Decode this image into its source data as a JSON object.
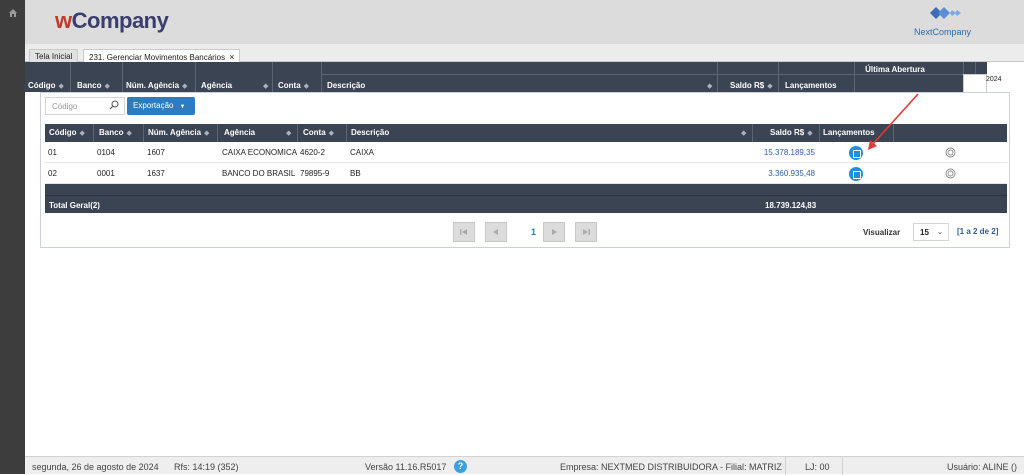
{
  "app": {
    "brand_w": "w",
    "brand_rest": "Company",
    "nc_brand": "NextCompany"
  },
  "tabs": [
    {
      "label": "Tela Inicial"
    },
    {
      "label": "231. Gerenciar Movimentos Bancários"
    }
  ],
  "background_grid": {
    "group_header": "Última Abertura",
    "headers": [
      "Código",
      "Banco",
      "Núm. Agência",
      "Agência",
      "Conta",
      "Descrição",
      "Saldo R$",
      "Lançamentos"
    ],
    "year_fragment": "2024"
  },
  "toolbar": {
    "search_placeholder": "Código",
    "export_label": "Exportação"
  },
  "grid": {
    "headers": [
      "Código",
      "Banco",
      "Núm. Agência",
      "Agência",
      "Conta",
      "Descrição",
      "Saldo R$",
      "Lançamentos"
    ],
    "rows": [
      {
        "codigo": "01",
        "banco": "0104",
        "num_agencia": "1607",
        "agencia": "CAIXA ECONOMICA",
        "conta": "4620-2",
        "descricao": "CAIXA",
        "saldo": "15.378.189,35"
      },
      {
        "codigo": "02",
        "banco": "0001",
        "num_agencia": "1637",
        "agencia": "BANCO DO BRASIL",
        "conta": "79895-9",
        "descricao": "BB",
        "saldo": "3.360.935,48"
      }
    ],
    "total_label": "Total Geral(2)",
    "total_value": "18.739.124,83"
  },
  "pager": {
    "current_page": "1",
    "view_label": "Visualizar",
    "page_size": "15",
    "range": "[1 a 2 de 2]"
  },
  "status": {
    "date": "segunda, 26 de agosto de 2024",
    "refresh": "Rfs: 14:19 (352)",
    "version": "Versão 11.16.R5017",
    "help": "?",
    "empresa": "Empresa: NEXTMED DISTRIBUIDORA - Filial: MATRIZ",
    "loja": "LJ: 00",
    "usuario": "Usuário: ALINE ()"
  },
  "colors": {
    "header_dark": "#3b4452",
    "accent_blue": "#2e7bbf",
    "annotation_red": "#e53935"
  }
}
